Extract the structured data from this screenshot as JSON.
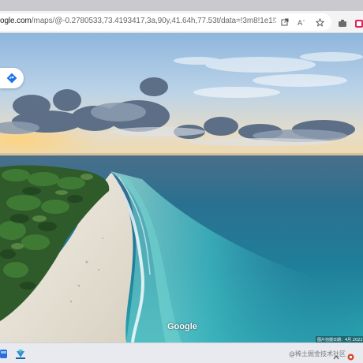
{
  "browser": {
    "url_host": "ogle.com",
    "url_path": "/maps/@-0.2780533,73.4193417,3a,90y,41.64h,77.53t/data=!3m8!1e1!3m6!1sAF1QipNvB5WajeT..."
  },
  "map": {
    "logo": "Google",
    "capture_text": "图片拍摄日期：4月 2022"
  },
  "taskbar": {
    "watermark": "@稀土掘金技术社区"
  },
  "colors": {
    "sky_top": "#8fb6dc",
    "ocean_deep": "#1b6e93",
    "ocean_shallow": "#3fb8c0",
    "sand": "#e8e3d8",
    "palms": "#2f5a2a"
  }
}
